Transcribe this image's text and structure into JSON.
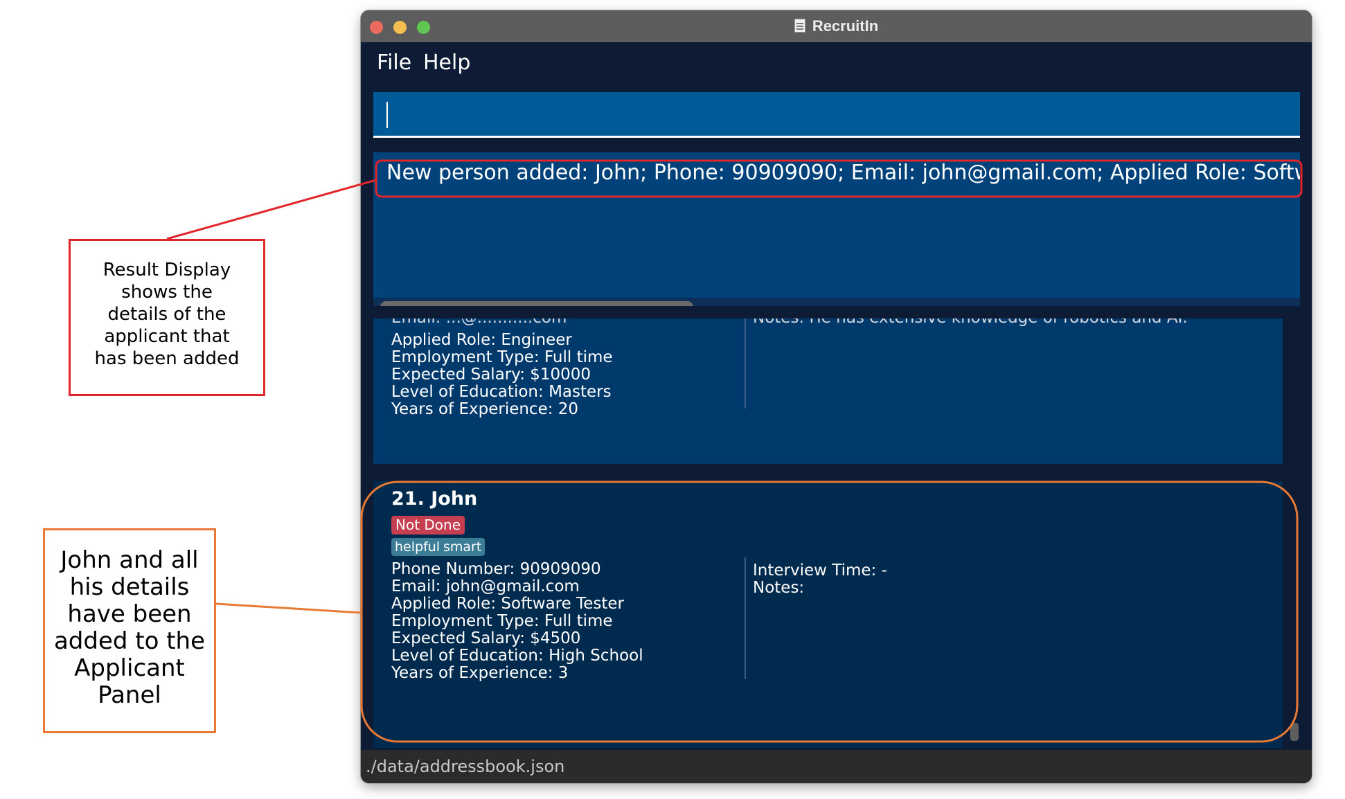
{
  "window": {
    "title": "RecruitIn"
  },
  "menu": {
    "items": [
      "File",
      "Help"
    ]
  },
  "command_box": {
    "value": ""
  },
  "result_display": {
    "text": "New person added: John; Phone: 90909090; Email: john@gmail.com; Applied Role: Software Tester;"
  },
  "previous_card": {
    "partial_top_left": "Email: ...@...........com",
    "partial_top_right": "Notes: He has extensive knowledge of robotics and AI.",
    "lines": [
      "Applied Role: Engineer",
      "Employment Type: Full time",
      "Expected Salary: $10000",
      "Level of Education: Masters",
      "Years of Experience: 20"
    ]
  },
  "current_card": {
    "name": "21.  John",
    "status": "Not Done",
    "tags": [
      "helpful",
      "smart"
    ],
    "left_lines": [
      "Phone Number: 90909090",
      "Email: john@gmail.com",
      "Applied Role: Software Tester",
      "Employment Type: Full time",
      "Expected Salary: $4500",
      "Level of Education: High School",
      "Years of Experience: 3"
    ],
    "right_lines": [
      "Interview Time: -",
      "Notes:"
    ]
  },
  "status_bar": {
    "path": "./data/addressbook.json"
  },
  "annotations": {
    "result_display_note": [
      "Result Display",
      "shows the",
      "details of the",
      "applicant that",
      "has been added"
    ],
    "applicant_panel_note": [
      "John and all",
      "his details",
      "have been",
      "added to the",
      "Applicant",
      "Panel"
    ]
  },
  "colors": {
    "annotation_red": "#e2252b",
    "annotation_orange": "#e97a35",
    "status_badge": "#c63f51",
    "tag": "#3b7c96",
    "command_box": "#005a97",
    "result_display": "#02427a"
  }
}
